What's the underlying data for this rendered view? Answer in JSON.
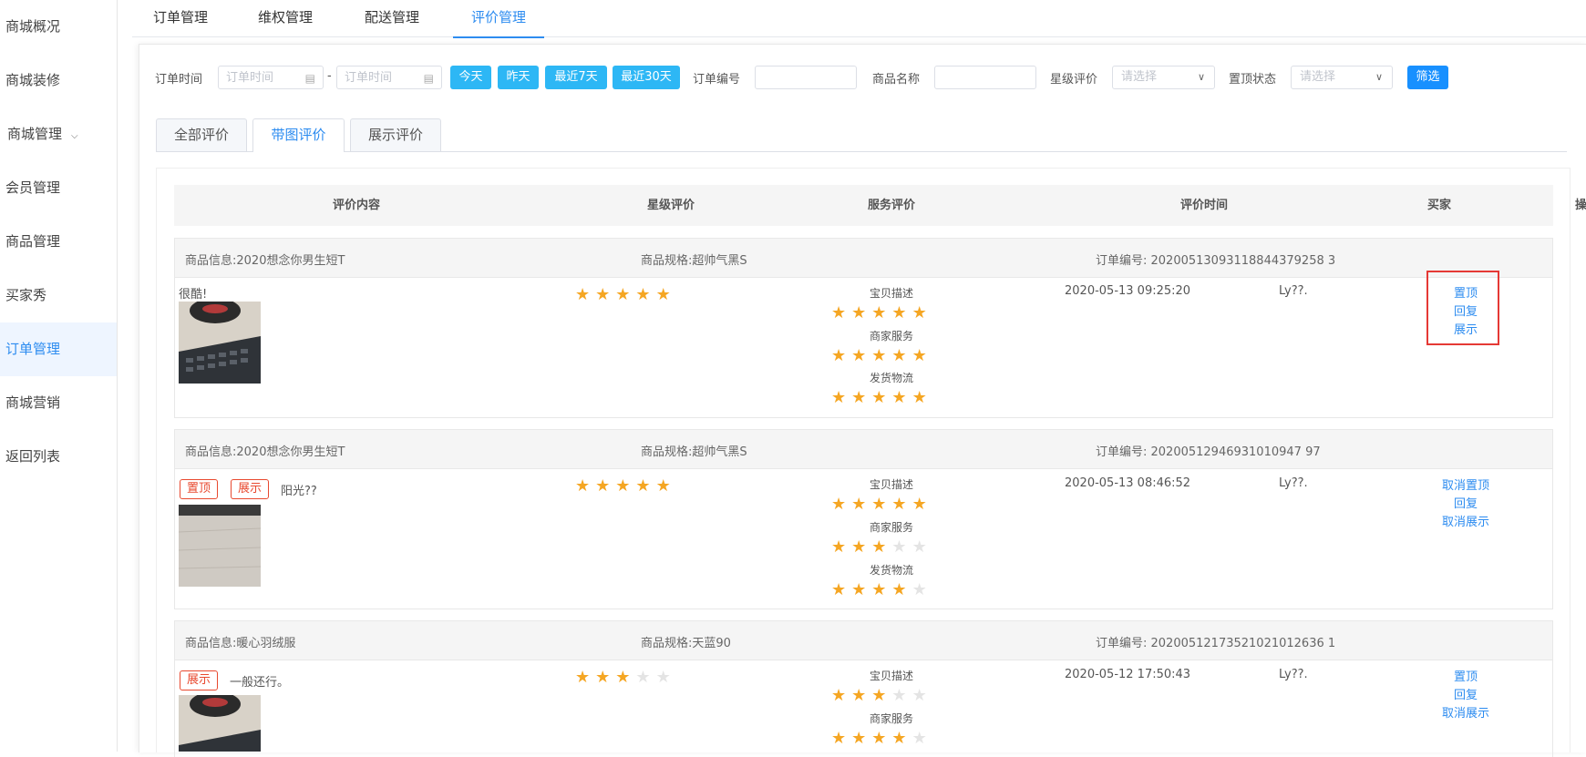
{
  "sidebar": {
    "items": [
      {
        "label": "商城概况",
        "active": false
      },
      {
        "label": "商城装修",
        "active": false
      },
      {
        "label": "商城管理",
        "active": false,
        "has_children": true
      },
      {
        "label": "会员管理",
        "active": false
      },
      {
        "label": "商品管理",
        "active": false
      },
      {
        "label": "买家秀",
        "active": false
      },
      {
        "label": "订单管理",
        "active": true
      },
      {
        "label": "商城营销",
        "active": false
      },
      {
        "label": "返回列表",
        "active": false
      }
    ]
  },
  "top_tabs": [
    "订单管理",
    "维权管理",
    "配送管理",
    "评价管理"
  ],
  "top_tab_active": "评价管理",
  "filters": {
    "order_time_label": "订单时间",
    "date_start_placeholder": "订单时间",
    "date_sep": "-",
    "date_end_placeholder": "订单时间",
    "quick_buttons": [
      "今天",
      "昨天",
      "最近7天",
      "最近30天"
    ],
    "order_no_label": "订单编号",
    "product_name_label": "商品名称",
    "star_label": "星级评价",
    "star_placeholder": "请选择",
    "pin_label": "置顶状态",
    "pin_placeholder": "请选择",
    "filter_button": "筛选"
  },
  "sub_tabs": [
    "全部评价",
    "带图评价",
    "展示评价"
  ],
  "sub_tab_active": "带图评价",
  "table": {
    "headers": [
      "评价内容",
      "星级评价",
      "服务评价",
      "评价时间",
      "买家",
      "操作"
    ],
    "service_labels": [
      "宝贝描述",
      "商家服务",
      "发货物流"
    ],
    "rows": [
      {
        "product_info": "商品信息:2020想念你男生短T",
        "spec": "商品规格:超帅气黑S",
        "order_no": "订单编号:  20200513093118844379258 3",
        "tags": [],
        "content": "很酷!",
        "rating": 5,
        "service": [
          5,
          5,
          5
        ],
        "time": "2020-05-13 09:25:20",
        "buyer": "Ly??.",
        "ops": [
          "置顶",
          "回复",
          "展示"
        ]
      },
      {
        "product_info": "商品信息:2020想念你男生短T",
        "spec": "商品规格:超帅气黑S",
        "order_no": "订单编号:  20200512946931010947 97",
        "tags": [
          "置顶",
          "展示"
        ],
        "content": "阳光??",
        "rating": 5,
        "service": [
          5,
          3,
          4
        ],
        "time": "2020-05-13 08:46:52",
        "buyer": "Ly??.",
        "ops": [
          "取消置顶",
          "回复",
          "取消展示"
        ]
      },
      {
        "product_info": "商品信息:暖心羽绒服",
        "spec": "商品规格:天蓝90",
        "order_no": "订单编号:  20200512173521021012636 1",
        "tags": [
          "展示"
        ],
        "content": "一般还行。",
        "rating": 3,
        "service": [
          3,
          4
        ],
        "time": "2020-05-12 17:50:43",
        "buyer": "Ly??.",
        "ops": [
          "置顶",
          "回复",
          "取消展示"
        ]
      }
    ]
  },
  "colors": {
    "accent": "#2d8cf0",
    "star": "#f5a623",
    "tag": "#e8492f",
    "highlight": "#e53935",
    "quick_button": "#2db7f5"
  }
}
